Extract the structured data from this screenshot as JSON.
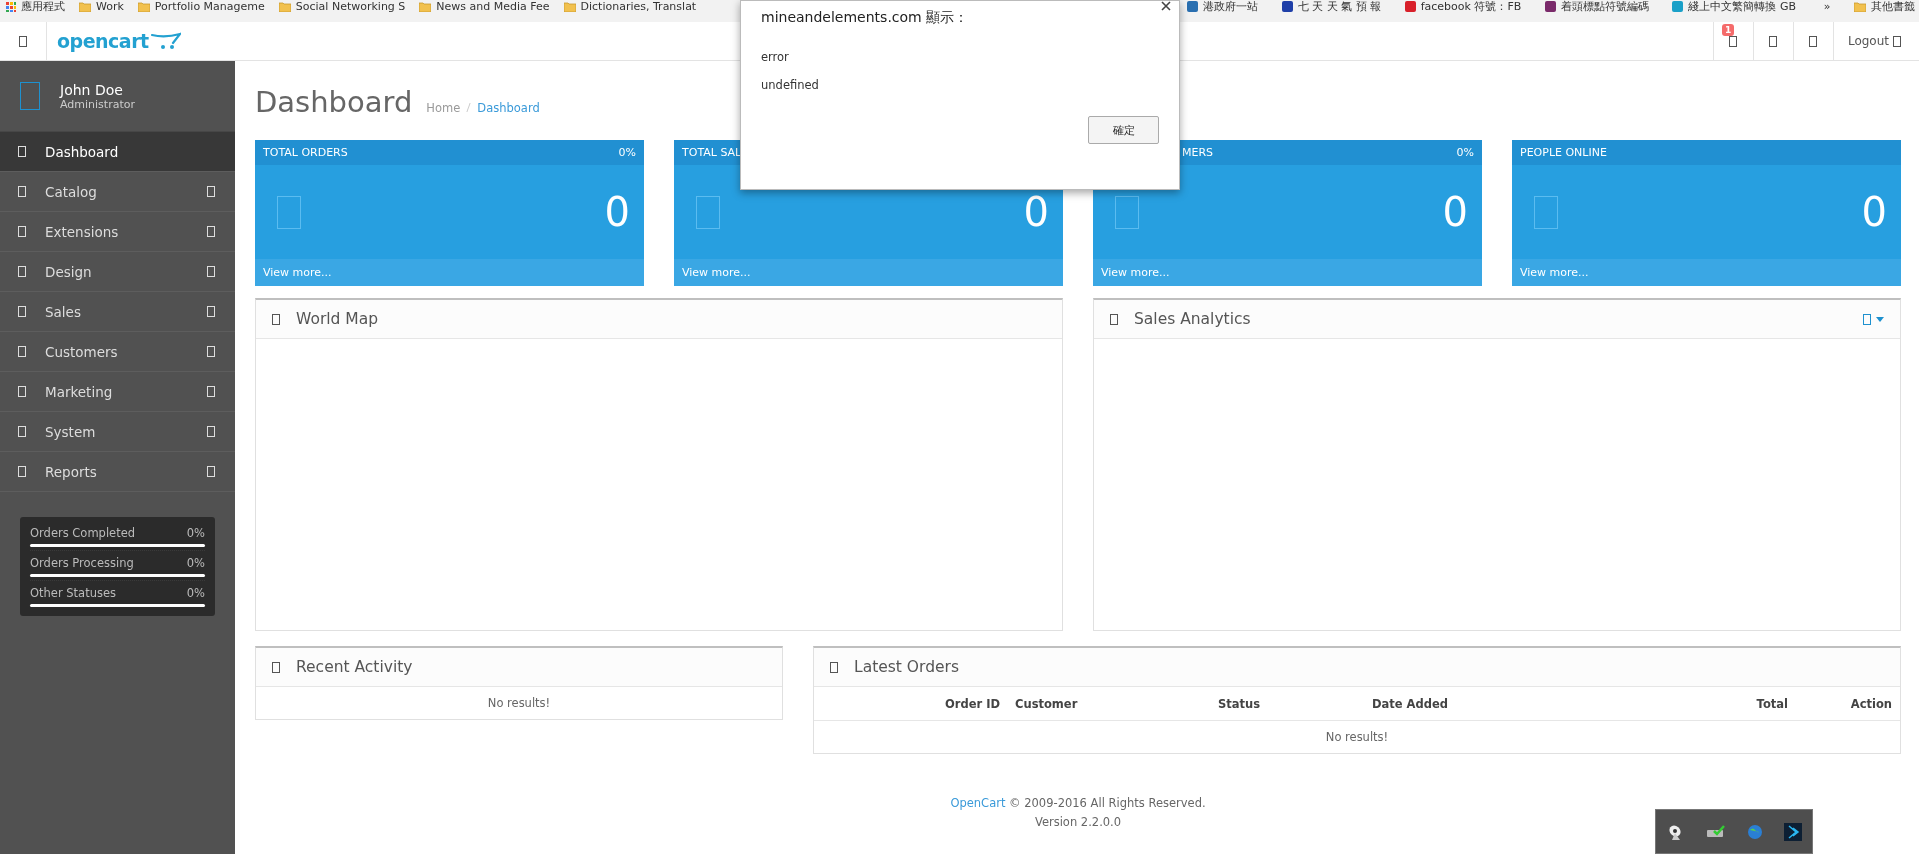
{
  "bookmarks": [
    {
      "label": "應用程式",
      "kind": "apps"
    },
    {
      "label": "Work",
      "kind": "folder"
    },
    {
      "label": "Portfolio Manageme",
      "kind": "folder"
    },
    {
      "label": "Social Networking S",
      "kind": "folder"
    },
    {
      "label": "News and Media Fee",
      "kind": "folder"
    },
    {
      "label": "Dictionaries, Translat",
      "kind": "folder"
    },
    {
      "label": "港政府一站",
      "kind": "site",
      "color": "#2a6fb0"
    },
    {
      "label": "七 天 天 氣 預 報",
      "kind": "site",
      "color": "#1f3fa8"
    },
    {
      "label": "facebook 符號：FB",
      "kind": "site",
      "color": "#d8202a"
    },
    {
      "label": "着頭標點符號編碼",
      "kind": "site",
      "color": "#7a2a6a"
    },
    {
      "label": "綫上中文繁簡轉換 GB",
      "kind": "site",
      "color": "#1aa0c8"
    },
    {
      "label": "»",
      "kind": "more"
    },
    {
      "label": "其他書籤",
      "kind": "folder"
    }
  ],
  "topbar": {
    "logo": "opencart",
    "badge": "1",
    "logout": "Logout"
  },
  "sidebar": {
    "user": {
      "name": "John Doe",
      "role": "Administrator"
    },
    "menu": [
      {
        "label": "Dashboard",
        "selected": true,
        "expandable": false
      },
      {
        "label": "Catalog",
        "selected": false,
        "expandable": true
      },
      {
        "label": "Extensions",
        "selected": false,
        "expandable": true
      },
      {
        "label": "Design",
        "selected": false,
        "expandable": true
      },
      {
        "label": "Sales",
        "selected": false,
        "expandable": true
      },
      {
        "label": "Customers",
        "selected": false,
        "expandable": true
      },
      {
        "label": "Marketing",
        "selected": false,
        "expandable": true
      },
      {
        "label": "System",
        "selected": false,
        "expandable": true
      },
      {
        "label": "Reports",
        "selected": false,
        "expandable": true
      }
    ],
    "statuses": [
      {
        "label": "Orders Completed",
        "value": "0%",
        "level": 0
      },
      {
        "label": "Orders Processing",
        "value": "0%",
        "level": 0
      },
      {
        "label": "Other Statuses",
        "value": "0%",
        "level": 0
      }
    ]
  },
  "page": {
    "title": "Dashboard",
    "breadcrumb": [
      "Home",
      "Dashboard"
    ]
  },
  "tiles": [
    {
      "title": "TOTAL ORDERS",
      "percent": "0%",
      "value": "0",
      "link": "View more..."
    },
    {
      "title": "TOTAL SAL",
      "value": "0",
      "link": "View more..."
    },
    {
      "title": "MERS",
      "covered": true,
      "percent": "0%",
      "value": "0",
      "link": "View more..."
    },
    {
      "title": "PEOPLE ONLINE",
      "value": "0",
      "link": "View more..."
    }
  ],
  "world_map": {
    "title": "World Map"
  },
  "sales_analytics": {
    "title": "Sales Analytics"
  },
  "recent_activity": {
    "title": "Recent Activity",
    "empty": "No results!"
  },
  "latest_orders": {
    "title": "Latest Orders",
    "columns": [
      "Order ID",
      "Customer",
      "Status",
      "Date Added",
      "Total",
      "Action"
    ],
    "empty": "No results!"
  },
  "footer": {
    "link": "OpenCart",
    "text": "© 2009-2016 All Rights Reserved.",
    "version": "Version 2.2.0.0"
  },
  "dialog": {
    "title": "mineandelements.com 顯示：",
    "lines": [
      "error",
      "undefined"
    ],
    "button": "確定"
  }
}
